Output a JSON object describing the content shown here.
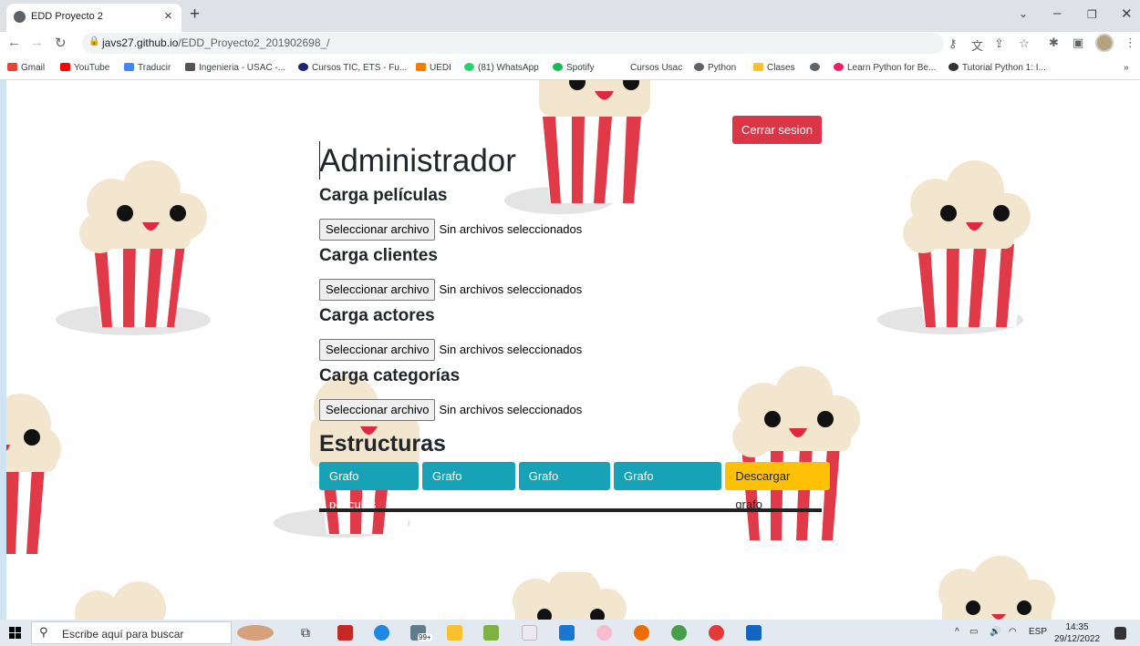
{
  "browser": {
    "tab_title": "EDD Proyecto 2",
    "url_host": "javs27.github.io",
    "url_path": "/EDD_Proyecto2_201902698_/",
    "bookmarks": [
      "Gmail",
      "YouTube",
      "Traducir",
      "Ingenieria - USAC -...",
      "Cursos TIC, ETS - Fu...",
      "UEDI",
      "(81) WhatsApp",
      "Spotify",
      "Cursos Usac",
      "Python",
      "Clases",
      "",
      "Learn Python for Be...",
      "Tutorial Python 1: I..."
    ],
    "bookmark_more": "»"
  },
  "page": {
    "title": "Administrador",
    "logout_label": "Cerrar sesion",
    "uploads": [
      {
        "heading": "Carga películas",
        "button": "Seleccionar archivo",
        "status": "Sin archivos seleccionados"
      },
      {
        "heading": "Carga clientes",
        "button": "Seleccionar archivo",
        "status": "Sin archivos seleccionados"
      },
      {
        "heading": "Carga actores",
        "button": "Seleccionar archivo",
        "status": "Sin archivos seleccionados"
      },
      {
        "heading": "Carga categorías",
        "button": "Seleccionar archivo",
        "status": "Sin archivos seleccionados"
      }
    ],
    "structures_heading": "Estructuras",
    "graph_buttons": [
      "Grafo películas",
      "Grafo clientes",
      "Grafo actores",
      "Grafo categorías"
    ],
    "download_label": "Descargar grafo"
  },
  "taskbar": {
    "search_placeholder": "Escribe aquí para buscar",
    "badge": "99+",
    "lang": "ESP",
    "time": "14:35",
    "date": "29/12/2022"
  },
  "colors": {
    "danger": "#dc3545",
    "info": "#17a2b8",
    "warning": "#ffc107"
  }
}
